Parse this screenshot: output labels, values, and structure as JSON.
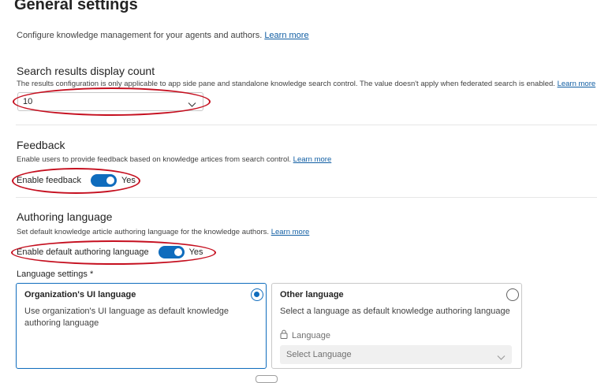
{
  "page": {
    "title": "General settings",
    "intro_text": "Configure knowledge management for your agents and authors.",
    "intro_link": "Learn more"
  },
  "search_results": {
    "title": "Search results display count",
    "description": "The results configuration is only applicable to app side pane and standalone knowledge search control. The value doesn't apply when federated search is enabled.",
    "link": "Learn more",
    "selected_value": "10"
  },
  "feedback": {
    "title": "Feedback",
    "description": "Enable users to provide feedback based on knowledge artices from search control.",
    "link": "Learn more",
    "toggle_label": "Enable feedback",
    "toggle_state": "Yes",
    "toggle_on": true
  },
  "authoring_language": {
    "title": "Authoring language",
    "description": "Set default knowledge article authoring language for the knowledge authors.",
    "link": "Learn more",
    "toggle_label": "Enable default authoring language",
    "toggle_state": "Yes",
    "toggle_on": true
  },
  "language_settings": {
    "label": "Language settings",
    "required_marker": "*",
    "options": [
      {
        "title": "Organization's UI language",
        "description": "Use organization's UI language as default knowledge authoring language",
        "selected": true
      },
      {
        "title": "Other language",
        "description": "Select a language as default knowledge authoring language",
        "selected": false,
        "field_label": "Language",
        "field_placeholder": "Select Language"
      }
    ]
  },
  "colors": {
    "accent": "#0f6cbd",
    "link": "#115ea3",
    "annotation": "#c50f1f"
  }
}
